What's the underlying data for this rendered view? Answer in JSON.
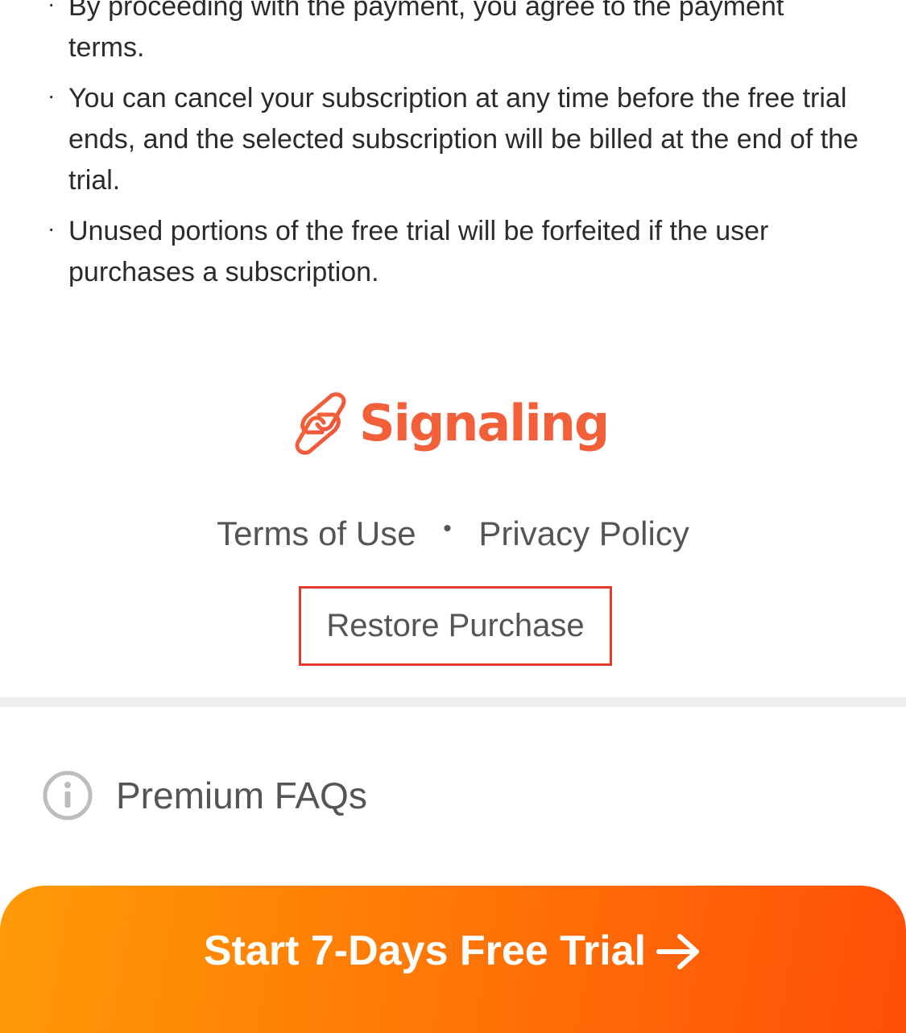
{
  "terms": [
    {
      "bullet": "·",
      "text": "By proceeding with the payment, you agree to the payment terms."
    },
    {
      "bullet": "·",
      "text": "You can cancel your subscription at any time before the free trial ends, and the selected subscription will be billed at the end of the trial."
    },
    {
      "bullet": "·",
      "text": "Unused portions of the free trial will be forfeited if the user purchases a subscription."
    }
  ],
  "brand": {
    "name": "Signaling",
    "logo_icon": "chain-link-logo-icon",
    "color": "#f2603a"
  },
  "links": {
    "terms": "Terms of Use",
    "separator": "•",
    "privacy": "Privacy Policy"
  },
  "restore": {
    "label": "Restore Purchase",
    "highlight_color": "#e53b2c"
  },
  "faq": {
    "icon": "info-icon",
    "label": "Premium FAQs"
  },
  "cta": {
    "label": "Start 7-Days Free Trial",
    "icon": "arrow-right-icon",
    "gradient_start": "#ff9a07",
    "gradient_end": "#ff4e08"
  }
}
